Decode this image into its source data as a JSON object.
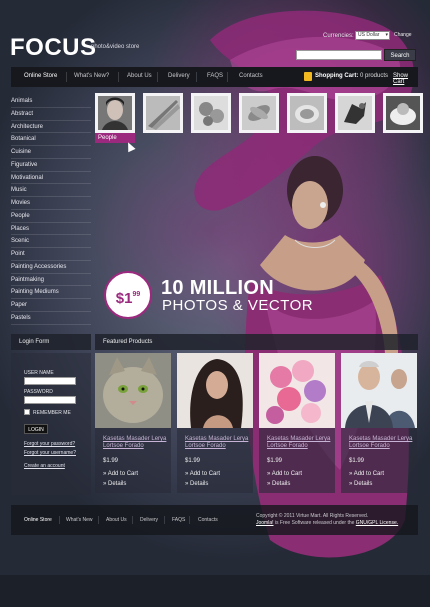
{
  "header": {
    "logo": "FOCUS",
    "logo_sub": "photo&video store",
    "currencies_label": "Currencies:",
    "currency_value": "US Dollar",
    "change_label": "Change",
    "search_label": "Search"
  },
  "nav": {
    "items": [
      "Online Store",
      "What's New?",
      "About Us",
      "Delivery",
      "FAQS",
      "Contacts"
    ],
    "cart_label": "Shopping Cart:",
    "cart_count": "0 products",
    "show_cart": "Show Cart"
  },
  "sidebar": {
    "categories": [
      "Animals",
      "Abstract",
      "Architecture",
      "Botanical",
      "Cuisine",
      "Figurative",
      "Motivational",
      "Music",
      "Movies",
      "People",
      "Places",
      "Scenic",
      "Point",
      "Painting Accessories",
      "Paintmaking",
      "Painting Mediums",
      "Paper",
      "Pastels"
    ]
  },
  "thumbs": {
    "active_label": "People",
    "items": [
      "people",
      "architecture",
      "flowers",
      "botanical",
      "shell",
      "animal",
      "cuisine"
    ]
  },
  "promo": {
    "price": "$1",
    "price_cents": "99",
    "line1": "10 MILLION",
    "line2": "PHOTOS & VECTOR"
  },
  "login": {
    "title": "Login Form",
    "user_label": "USER NAME",
    "password_label": "PASSWORD",
    "remember_label": "REMEMBER ME",
    "login_button": "LOGIN",
    "forgot_password": "Forgot your password?",
    "forgot_username": "Forgot your username?",
    "create_account": "Create an account"
  },
  "products": {
    "title": "Featured Products",
    "items": [
      {
        "name": "Kasetas Masader Lerya Lortsoe Forado",
        "price": "$1.99",
        "add": "Add to Cart",
        "details": "Details",
        "image": "cat"
      },
      {
        "name": "Kasetas Masader Lerya Lortsoe Forado",
        "price": "$1.99",
        "add": "Add to Cart",
        "details": "Details",
        "image": "woman"
      },
      {
        "name": "Kasetas Masader Lerya Lortsoe Forado",
        "price": "$1.99",
        "add": "Add to Cart",
        "details": "Details",
        "image": "flowers"
      },
      {
        "name": "Kasetas Masader Lerya Lortsoe Forado",
        "price": "$1.99",
        "add": "Add to Cart",
        "details": "Details",
        "image": "business-people"
      }
    ]
  },
  "footer": {
    "items": [
      "Online Store",
      "What's New",
      "About Us",
      "Delivery",
      "FAQS",
      "Contacts"
    ],
    "copyright": "Copyright © 2011 Virtue Mart. All Rights Reserved.",
    "joomla": "Joomla!",
    "license_text": "is Free Software released under the",
    "license": "GNU/GPL License."
  },
  "colors": {
    "accent": "#9b2a7e",
    "nav_bg": "#16181d",
    "cart_icon": "#f2b81f"
  }
}
